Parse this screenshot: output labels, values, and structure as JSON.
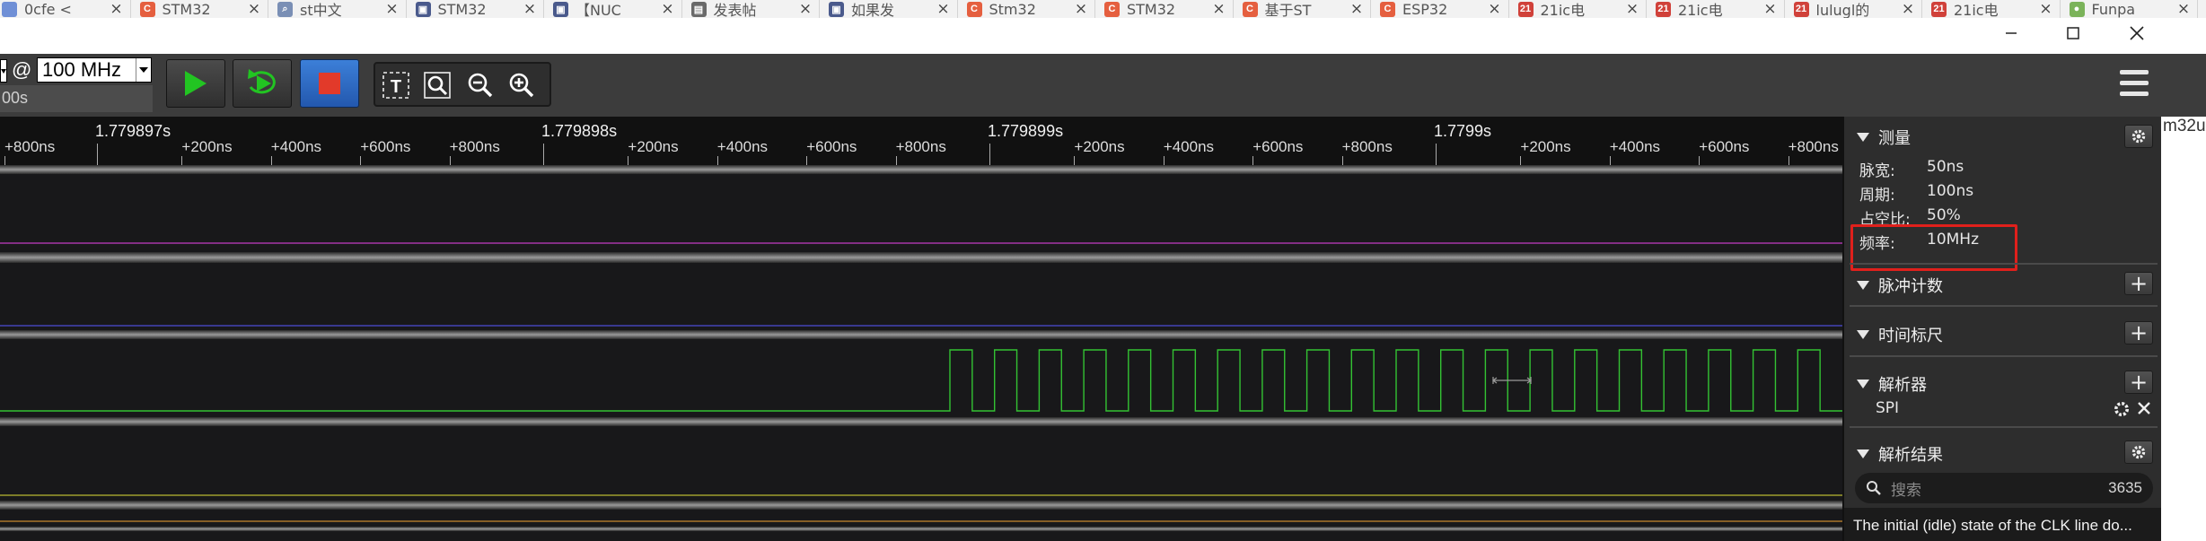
{
  "browser_tabs": [
    {
      "label": "0cfe <",
      "icon": "generic-site-icon",
      "icon_color": "#6f8fd6",
      "icon_text": ""
    },
    {
      "label": "STM32",
      "icon": "csdn-icon",
      "icon_color": "#e55f3f",
      "icon_text": "C"
    },
    {
      "label": "st中文",
      "icon": "search-icon",
      "icon_color": "#7a8fb5",
      "icon_text": "⌕"
    },
    {
      "label": "STM32",
      "icon": "article-icon",
      "icon_color": "#4a5a8c",
      "icon_text": "▣"
    },
    {
      "label": "【NUC",
      "icon": "article-icon",
      "icon_color": "#4a5a8c",
      "icon_text": "▣"
    },
    {
      "label": "发表帖",
      "icon": "forum-icon",
      "icon_color": "#6a6a6a",
      "icon_text": "▤"
    },
    {
      "label": "如果发",
      "icon": "article-icon",
      "icon_color": "#4a5a8c",
      "icon_text": "▣"
    },
    {
      "label": "Stm32",
      "icon": "csdn-icon",
      "icon_color": "#e55f3f",
      "icon_text": "C"
    },
    {
      "label": "STM32",
      "icon": "csdn-icon",
      "icon_color": "#e55f3f",
      "icon_text": "C"
    },
    {
      "label": "基于ST",
      "icon": "csdn-icon",
      "icon_color": "#e55f3f",
      "icon_text": "C"
    },
    {
      "label": "ESP32",
      "icon": "csdn-icon",
      "icon_color": "#e55f3f",
      "icon_text": "C"
    },
    {
      "label": "21ic电",
      "icon": "21ic-icon",
      "icon_color": "#d0413a",
      "icon_text": "21"
    },
    {
      "label": "21ic电",
      "icon": "21ic-icon",
      "icon_color": "#d0413a",
      "icon_text": "21"
    },
    {
      "label": "lulugl的",
      "icon": "21ic-icon",
      "icon_color": "#d0413a",
      "icon_text": "21"
    },
    {
      "label": "21ic电",
      "icon": "21ic-icon",
      "icon_color": "#d0413a",
      "icon_text": "21"
    },
    {
      "label": "Funpa",
      "icon": "funpack-icon",
      "icon_color": "#7bb35a",
      "icon_text": "●"
    }
  ],
  "toolbar": {
    "sample_rate": "100 MHz",
    "at_symbol": "@",
    "duration_partial": "00s"
  },
  "ruler": {
    "major_labels": [
      "1.779897s",
      "1.779898s",
      "1.779899s",
      "1.7799s"
    ],
    "minor_labels": [
      "+200ns",
      "+400ns",
      "+600ns",
      "+800ns"
    ],
    "leading_label": "+800ns"
  },
  "panel": {
    "measure": {
      "title": "测量",
      "rows": [
        {
          "label": "脉宽:",
          "value": "50ns"
        },
        {
          "label": "周期:",
          "value": "100ns"
        },
        {
          "label": "占空比:",
          "value": "50%"
        },
        {
          "label": "频率:",
          "value": "10MHz"
        }
      ]
    },
    "pulse_count": {
      "title": "脉冲计数"
    },
    "timing_marker": {
      "title": "时间标尺"
    },
    "analyzer": {
      "title": "解析器",
      "items": [
        "SPI"
      ]
    },
    "results": {
      "title": "解析结果",
      "search_placeholder": "搜索",
      "count": "3635",
      "message": "The initial (idle) state of the CLK line do..."
    }
  },
  "right_edge_text": "m32u",
  "colors": {
    "channel_1": "#c33cc3",
    "channel_2": "#4d4dd6",
    "channel_3": "#33c233",
    "channel_4": "#b8b832",
    "channel_5": "#c7892f",
    "highlight_box": "#e0201c",
    "play_green": "#22c422",
    "stop_red": "#e23a2a",
    "stop_button_blue": "#2b6cc9"
  },
  "waveform": {
    "channel_3_clock": {
      "period_ns": 100,
      "duty_cycle": 0.5
    }
  }
}
